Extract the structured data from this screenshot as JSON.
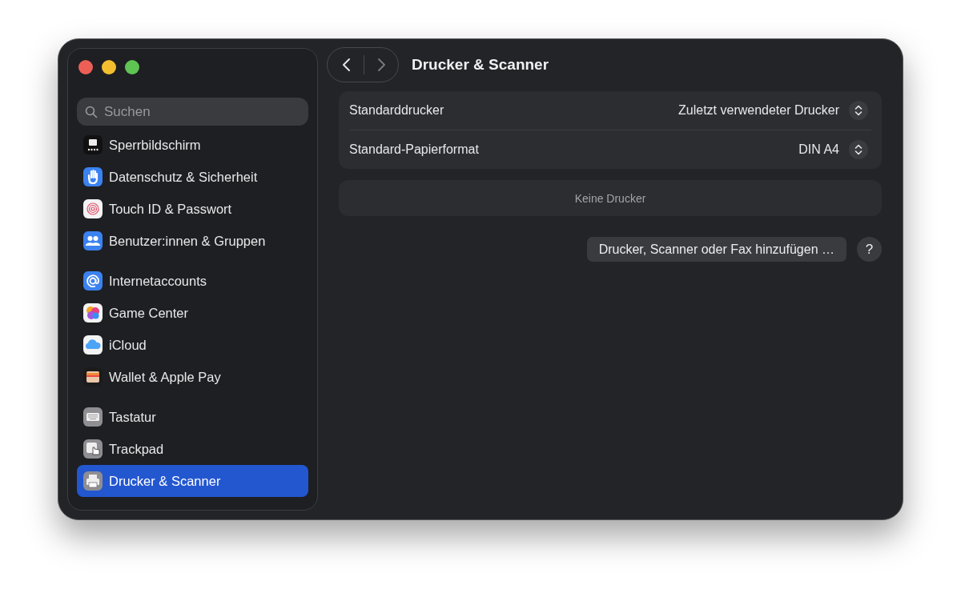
{
  "window": {
    "title": "Drucker & Scanner"
  },
  "search": {
    "placeholder": "Suchen"
  },
  "sidebar": {
    "groups": [
      {
        "items": [
          {
            "label": "Sperrbildschirm",
            "selected": false
          },
          {
            "label": "Datenschutz & Sicherheit",
            "selected": false
          },
          {
            "label": "Touch ID & Passwort",
            "selected": false
          },
          {
            "label": "Benutzer:innen & Gruppen",
            "selected": false
          }
        ]
      },
      {
        "items": [
          {
            "label": "Internetaccounts",
            "selected": false
          },
          {
            "label": "Game Center",
            "selected": false
          },
          {
            "label": "iCloud",
            "selected": false
          },
          {
            "label": "Wallet & Apple Pay",
            "selected": false
          }
        ]
      },
      {
        "items": [
          {
            "label": "Tastatur",
            "selected": false
          },
          {
            "label": "Trackpad",
            "selected": false
          },
          {
            "label": "Drucker & Scanner",
            "selected": true
          }
        ]
      }
    ]
  },
  "settings": [
    {
      "label": "Standarddrucker",
      "value": "Zuletzt verwendeter Drucker"
    },
    {
      "label": "Standard-Papierformat",
      "value": "DIN A4"
    }
  ],
  "printers": {
    "empty_text": "Keine Drucker"
  },
  "add_button": "Drucker, Scanner oder Fax hinzufügen …",
  "help_button": "?"
}
